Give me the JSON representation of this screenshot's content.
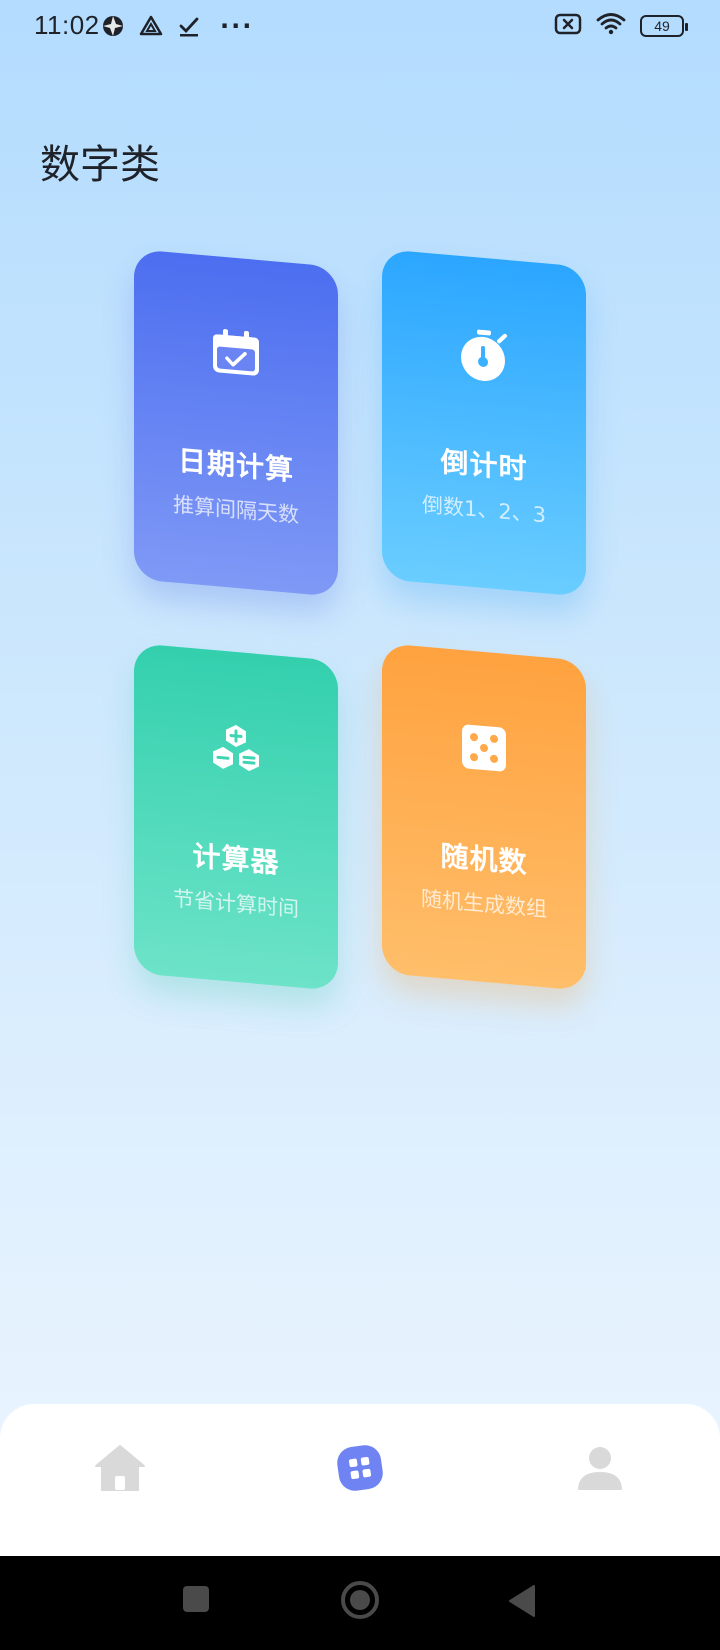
{
  "status_bar": {
    "time": "11:02",
    "left_icons": [
      "aperture-icon",
      "drive-icon",
      "checkmark-icon"
    ],
    "more": "···",
    "battery_level": "49",
    "right_icons": [
      "sim-off-icon",
      "wifi-icon",
      "battery-icon"
    ]
  },
  "page": {
    "title": "数字类"
  },
  "cards": [
    {
      "id": "date",
      "title": "日期计算",
      "subtitle": "推算间隔天数",
      "icon": "calendar-icon",
      "color_top": "#4c6ef0",
      "color_bottom": "#7f99f6"
    },
    {
      "id": "countdown",
      "title": "倒计时",
      "subtitle": "倒数1、2、3",
      "icon": "stopwatch-icon",
      "color_top": "#2ba6ff",
      "color_bottom": "#6acdff"
    },
    {
      "id": "calculator",
      "title": "计算器",
      "subtitle": "节省计算时间",
      "icon": "calculator-icon",
      "color_top": "#33d0ae",
      "color_bottom": "#6de3c8"
    },
    {
      "id": "random",
      "title": "随机数",
      "subtitle": "随机生成数组",
      "icon": "dice-icon",
      "color_top": "#ffa23f",
      "color_bottom": "#ffbe6a"
    }
  ],
  "bottom_nav": {
    "items": [
      {
        "id": "home",
        "icon": "home-icon",
        "active": false
      },
      {
        "id": "tools",
        "icon": "grid-icon",
        "active": true
      },
      {
        "id": "profile",
        "icon": "user-icon",
        "active": false
      }
    ],
    "active_color": "#6f84f2",
    "inactive_color": "#d9d9d9"
  },
  "system_nav": {
    "buttons": [
      "recent-apps-icon",
      "home-circle-icon",
      "back-icon"
    ]
  }
}
